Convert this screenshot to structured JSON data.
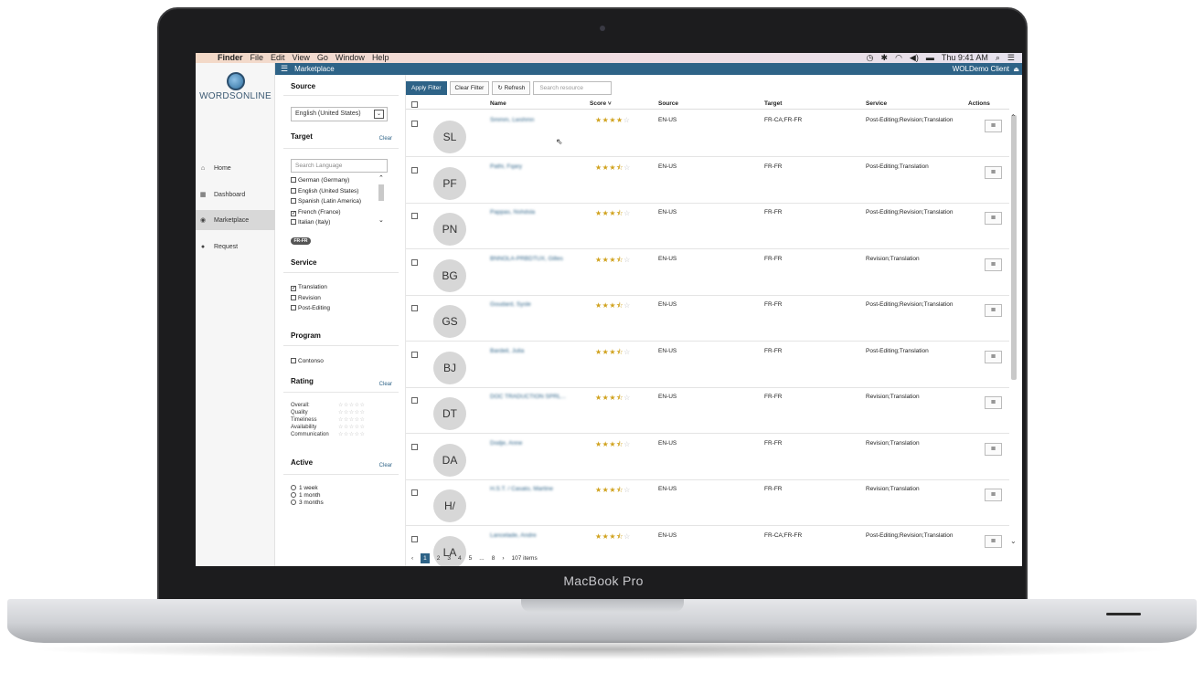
{
  "device_label": "MacBook Pro",
  "menubar": {
    "apple_glyph": "",
    "app": "Finder",
    "items": [
      "File",
      "Edit",
      "View",
      "Go",
      "Window",
      "Help"
    ],
    "clock": "Thu 9:41 AM"
  },
  "appbar": {
    "menu_icon": "hamburger-icon",
    "title": "Marketplace",
    "client": "WOLDemo Client"
  },
  "logo_text": "WORDSONLINE",
  "nav": [
    {
      "label": "Home",
      "icon": "home-icon"
    },
    {
      "label": "Dashboard",
      "icon": "dashboard-icon"
    },
    {
      "label": "Marketplace",
      "icon": "marketplace-icon",
      "active": true
    },
    {
      "label": "Request",
      "icon": "request-icon"
    }
  ],
  "filters": {
    "source": {
      "title": "Source",
      "selected": "English (United States)"
    },
    "target": {
      "title": "Target",
      "clear": "Clear",
      "placeholder": "Search Language",
      "options": [
        {
          "label": "German (Germany)",
          "checked": false
        },
        {
          "label": "English (United States)",
          "checked": false
        },
        {
          "label": "Spanish (Latin America)",
          "checked": false
        },
        {
          "label": "French (France)",
          "checked": true
        },
        {
          "label": "Italian (Italy)",
          "checked": false
        }
      ],
      "tag": "FR-FR"
    },
    "service": {
      "title": "Service",
      "options": [
        {
          "label": "Translation",
          "checked": true
        },
        {
          "label": "Revision",
          "checked": false
        },
        {
          "label": "Post-Editing",
          "checked": false
        }
      ]
    },
    "program": {
      "title": "Program",
      "options": [
        {
          "label": "Contonso",
          "checked": false
        }
      ]
    },
    "rating": {
      "title": "Rating",
      "clear": "Clear",
      "rows": [
        "Overall:",
        "Quality",
        "Timeliness",
        "Availability",
        "Communication"
      ]
    },
    "active": {
      "title": "Active",
      "clear": "Clear",
      "options": [
        "1 week",
        "1 month",
        "3 months"
      ]
    }
  },
  "toolbar": {
    "apply": "Apply Filter",
    "clear": "Clear Filter",
    "refresh": "Refresh",
    "search_placeholder": "Search resource"
  },
  "table": {
    "headers": {
      "name": "Name",
      "score": "Score ˅",
      "source": "Source",
      "target": "Target",
      "service": "Service",
      "actions": "Actions"
    },
    "rows": [
      {
        "initials": "SL",
        "name": "Smmm, Lwshmn",
        "stars": 4,
        "half": false,
        "source": "EN-US",
        "target": "FR-CA;FR-FR",
        "service": "Post-Editing;Revision;Translation"
      },
      {
        "initials": "PF",
        "name": "Pathi, Fqary",
        "stars": 3,
        "half": true,
        "source": "EN-US",
        "target": "FR-FR",
        "service": "Post-Editing;Translation"
      },
      {
        "initials": "PN",
        "name": "Pappas, Nshdsla",
        "stars": 3,
        "half": true,
        "source": "EN-US",
        "target": "FR-FR",
        "service": "Post-Editing;Revision;Translation"
      },
      {
        "initials": "BG",
        "name": "BNNOLA-PRBDTUX, Gilles",
        "stars": 3,
        "half": true,
        "source": "EN-US",
        "target": "FR-FR",
        "service": "Revision;Translation"
      },
      {
        "initials": "GS",
        "name": "Goudard, Sysle",
        "stars": 3,
        "half": true,
        "source": "EN-US",
        "target": "FR-FR",
        "service": "Post-Editing;Revision;Translation"
      },
      {
        "initials": "BJ",
        "name": "Bardeil, Julia",
        "stars": 3,
        "half": true,
        "source": "EN-US",
        "target": "FR-FR",
        "service": "Post-Editing;Translation"
      },
      {
        "initials": "DT",
        "name": "DOC TRADUCTION SPRL...",
        "stars": 3,
        "half": true,
        "source": "EN-US",
        "target": "FR-FR",
        "service": "Revision;Translation"
      },
      {
        "initials": "DA",
        "name": "Dodje, Anne",
        "stars": 3,
        "half": true,
        "source": "EN-US",
        "target": "FR-FR",
        "service": "Revision;Translation"
      },
      {
        "initials": "H/",
        "name": "H.S.T. / Casato, Martine",
        "stars": 3,
        "half": true,
        "source": "EN-US",
        "target": "FR-FR",
        "service": "Revision;Translation"
      },
      {
        "initials": "LA",
        "name": "Lancelade, Andre",
        "stars": 3,
        "half": true,
        "source": "EN-US",
        "target": "FR-CA;FR-FR",
        "service": "Post-Editing;Revision;Translation"
      }
    ]
  },
  "pager": {
    "prev": "‹",
    "pages": [
      "1",
      "2",
      "3",
      "4",
      "5",
      "...",
      "8"
    ],
    "next": "›",
    "total": "107 items"
  }
}
